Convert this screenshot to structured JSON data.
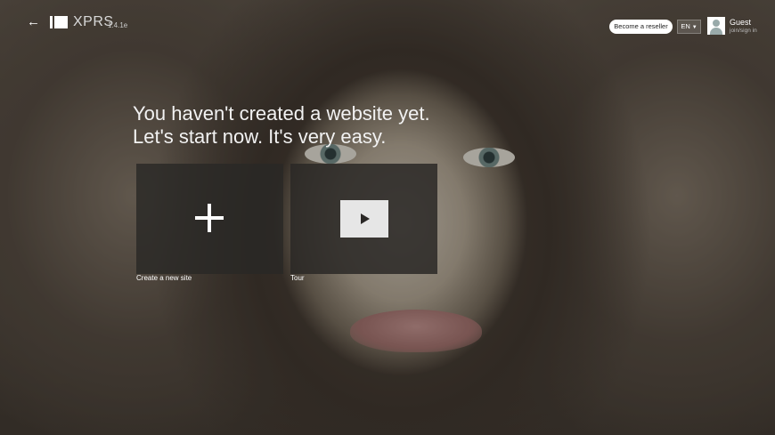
{
  "header": {
    "brand": "XPRS",
    "version": "1.4.1e",
    "reseller_label": "Become a reseller",
    "language": "EN",
    "user_name": "Guest",
    "user_link": "join/sign in"
  },
  "main": {
    "headline_line1": "You haven't created a website yet.",
    "headline_line2": "Let's start now. It's very easy.",
    "tiles": [
      {
        "label": "Create a new site",
        "icon": "plus-icon"
      },
      {
        "label": "Tour",
        "icon": "play-icon"
      }
    ]
  }
}
